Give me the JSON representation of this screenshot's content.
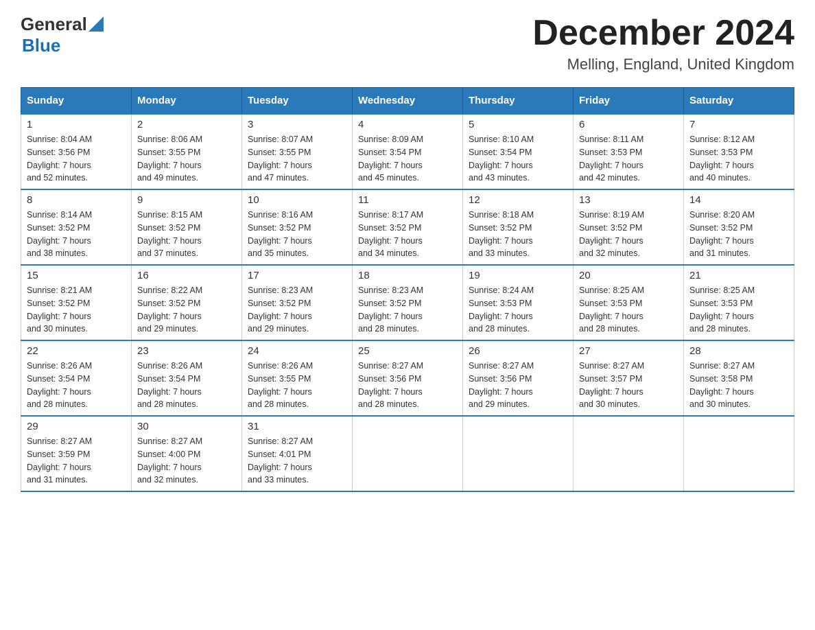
{
  "header": {
    "title": "December 2024",
    "subtitle": "Melling, England, United Kingdom",
    "logo_general": "General",
    "logo_blue": "Blue"
  },
  "days_of_week": [
    "Sunday",
    "Monday",
    "Tuesday",
    "Wednesday",
    "Thursday",
    "Friday",
    "Saturday"
  ],
  "weeks": [
    [
      {
        "day": "1",
        "sunrise": "8:04 AM",
        "sunset": "3:56 PM",
        "daylight": "7 hours and 52 minutes."
      },
      {
        "day": "2",
        "sunrise": "8:06 AM",
        "sunset": "3:55 PM",
        "daylight": "7 hours and 49 minutes."
      },
      {
        "day": "3",
        "sunrise": "8:07 AM",
        "sunset": "3:55 PM",
        "daylight": "7 hours and 47 minutes."
      },
      {
        "day": "4",
        "sunrise": "8:09 AM",
        "sunset": "3:54 PM",
        "daylight": "7 hours and 45 minutes."
      },
      {
        "day": "5",
        "sunrise": "8:10 AM",
        "sunset": "3:54 PM",
        "daylight": "7 hours and 43 minutes."
      },
      {
        "day": "6",
        "sunrise": "8:11 AM",
        "sunset": "3:53 PM",
        "daylight": "7 hours and 42 minutes."
      },
      {
        "day": "7",
        "sunrise": "8:12 AM",
        "sunset": "3:53 PM",
        "daylight": "7 hours and 40 minutes."
      }
    ],
    [
      {
        "day": "8",
        "sunrise": "8:14 AM",
        "sunset": "3:52 PM",
        "daylight": "7 hours and 38 minutes."
      },
      {
        "day": "9",
        "sunrise": "8:15 AM",
        "sunset": "3:52 PM",
        "daylight": "7 hours and 37 minutes."
      },
      {
        "day": "10",
        "sunrise": "8:16 AM",
        "sunset": "3:52 PM",
        "daylight": "7 hours and 35 minutes."
      },
      {
        "day": "11",
        "sunrise": "8:17 AM",
        "sunset": "3:52 PM",
        "daylight": "7 hours and 34 minutes."
      },
      {
        "day": "12",
        "sunrise": "8:18 AM",
        "sunset": "3:52 PM",
        "daylight": "7 hours and 33 minutes."
      },
      {
        "day": "13",
        "sunrise": "8:19 AM",
        "sunset": "3:52 PM",
        "daylight": "7 hours and 32 minutes."
      },
      {
        "day": "14",
        "sunrise": "8:20 AM",
        "sunset": "3:52 PM",
        "daylight": "7 hours and 31 minutes."
      }
    ],
    [
      {
        "day": "15",
        "sunrise": "8:21 AM",
        "sunset": "3:52 PM",
        "daylight": "7 hours and 30 minutes."
      },
      {
        "day": "16",
        "sunrise": "8:22 AM",
        "sunset": "3:52 PM",
        "daylight": "7 hours and 29 minutes."
      },
      {
        "day": "17",
        "sunrise": "8:23 AM",
        "sunset": "3:52 PM",
        "daylight": "7 hours and 29 minutes."
      },
      {
        "day": "18",
        "sunrise": "8:23 AM",
        "sunset": "3:52 PM",
        "daylight": "7 hours and 28 minutes."
      },
      {
        "day": "19",
        "sunrise": "8:24 AM",
        "sunset": "3:53 PM",
        "daylight": "7 hours and 28 minutes."
      },
      {
        "day": "20",
        "sunrise": "8:25 AM",
        "sunset": "3:53 PM",
        "daylight": "7 hours and 28 minutes."
      },
      {
        "day": "21",
        "sunrise": "8:25 AM",
        "sunset": "3:53 PM",
        "daylight": "7 hours and 28 minutes."
      }
    ],
    [
      {
        "day": "22",
        "sunrise": "8:26 AM",
        "sunset": "3:54 PM",
        "daylight": "7 hours and 28 minutes."
      },
      {
        "day": "23",
        "sunrise": "8:26 AM",
        "sunset": "3:54 PM",
        "daylight": "7 hours and 28 minutes."
      },
      {
        "day": "24",
        "sunrise": "8:26 AM",
        "sunset": "3:55 PM",
        "daylight": "7 hours and 28 minutes."
      },
      {
        "day": "25",
        "sunrise": "8:27 AM",
        "sunset": "3:56 PM",
        "daylight": "7 hours and 28 minutes."
      },
      {
        "day": "26",
        "sunrise": "8:27 AM",
        "sunset": "3:56 PM",
        "daylight": "7 hours and 29 minutes."
      },
      {
        "day": "27",
        "sunrise": "8:27 AM",
        "sunset": "3:57 PM",
        "daylight": "7 hours and 30 minutes."
      },
      {
        "day": "28",
        "sunrise": "8:27 AM",
        "sunset": "3:58 PM",
        "daylight": "7 hours and 30 minutes."
      }
    ],
    [
      {
        "day": "29",
        "sunrise": "8:27 AM",
        "sunset": "3:59 PM",
        "daylight": "7 hours and 31 minutes."
      },
      {
        "day": "30",
        "sunrise": "8:27 AM",
        "sunset": "4:00 PM",
        "daylight": "7 hours and 32 minutes."
      },
      {
        "day": "31",
        "sunrise": "8:27 AM",
        "sunset": "4:01 PM",
        "daylight": "7 hours and 33 minutes."
      },
      null,
      null,
      null,
      null
    ]
  ]
}
